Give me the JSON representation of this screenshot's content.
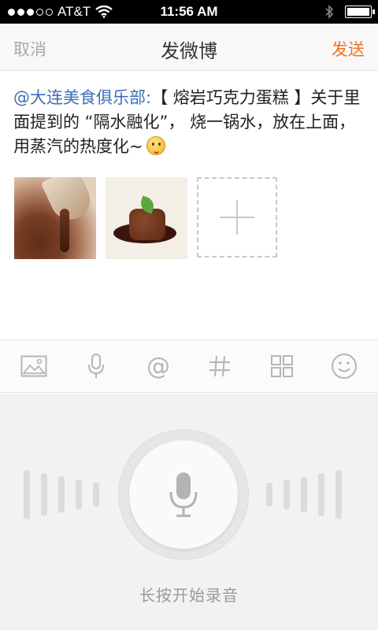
{
  "status_bar": {
    "carrier": "AT&T",
    "time": "11:56 AM",
    "signal_icon": "signal-dots-icon",
    "wifi_icon": "wifi-icon",
    "bluetooth_icon": "bluetooth-icon",
    "battery_icon": "battery-icon"
  },
  "nav": {
    "cancel_label": "取消",
    "title": "发微博",
    "send_label": "发送",
    "send_color": "#f07322"
  },
  "compose": {
    "mention": "@大连美食俱乐部:",
    "body": "【 熔岩巧克力蛋糕 】关于里面提到的 “隔水融化”， 烧一锅水，放在上面，用蒸汽的热度化~",
    "emoji_icon": "smiley-emoji-icon",
    "attachments": [
      {
        "name": "chocolate-sauce-photo"
      },
      {
        "name": "lava-cake-photo"
      }
    ],
    "add_photo_icon": "plus-icon"
  },
  "toolbar": {
    "items": [
      {
        "name": "picture-icon"
      },
      {
        "name": "microphone-icon"
      },
      {
        "name": "at-icon"
      },
      {
        "name": "hashtag-icon"
      },
      {
        "name": "grid-icon"
      },
      {
        "name": "smiley-icon"
      }
    ]
  },
  "voice": {
    "hint": "长按开始录音",
    "mic_icon": "microphone-icon"
  },
  "colors": {
    "mention": "#3b6fb6",
    "accent": "#f07322"
  }
}
